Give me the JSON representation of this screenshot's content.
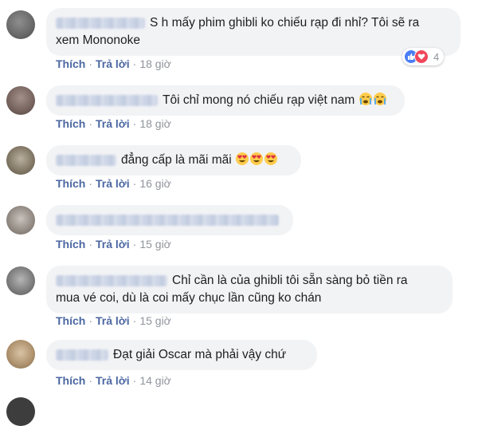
{
  "actions": {
    "like_label": "Thích",
    "reply_label": "Trả lời",
    "separator": "·"
  },
  "comments": [
    {
      "text": "S h mấy phim ghibli ko chiếu rạp đi nhỉ? Tôi sẽ ra\nxem Mononoke",
      "time": "18 giờ",
      "reactions": {
        "icons": [
          "like-icon",
          "love-icon"
        ],
        "count": "4"
      }
    },
    {
      "text": "Tôi chỉ mong nó chiếu rạp việt nam",
      "emojis": [
        "crying-face-emoji",
        "crying-face-emoji"
      ],
      "time": "18 giờ"
    },
    {
      "text": "đẳng cấp là mãi mãi",
      "emojis": [
        "heart-eyes-emoji",
        "heart-eyes-emoji",
        "heart-eyes-emoji"
      ],
      "time": "16 giờ"
    },
    {
      "text": "",
      "time": "15 giờ"
    },
    {
      "text": "Chỉ cần là của ghibli tôi sẵn sàng bỏ tiền ra\nmua vé coi, dù là coi mấy chục lần cũng ko chán",
      "time": "15 giờ"
    },
    {
      "text": "Đạt giải Oscar mà phải vậy chứ",
      "time": "14 giờ"
    }
  ],
  "colors": {
    "bubble": "#f2f3f5",
    "link": "#4b67a1",
    "meta": "#90949c",
    "like": "#4a7ef6",
    "love": "#f0475b"
  }
}
